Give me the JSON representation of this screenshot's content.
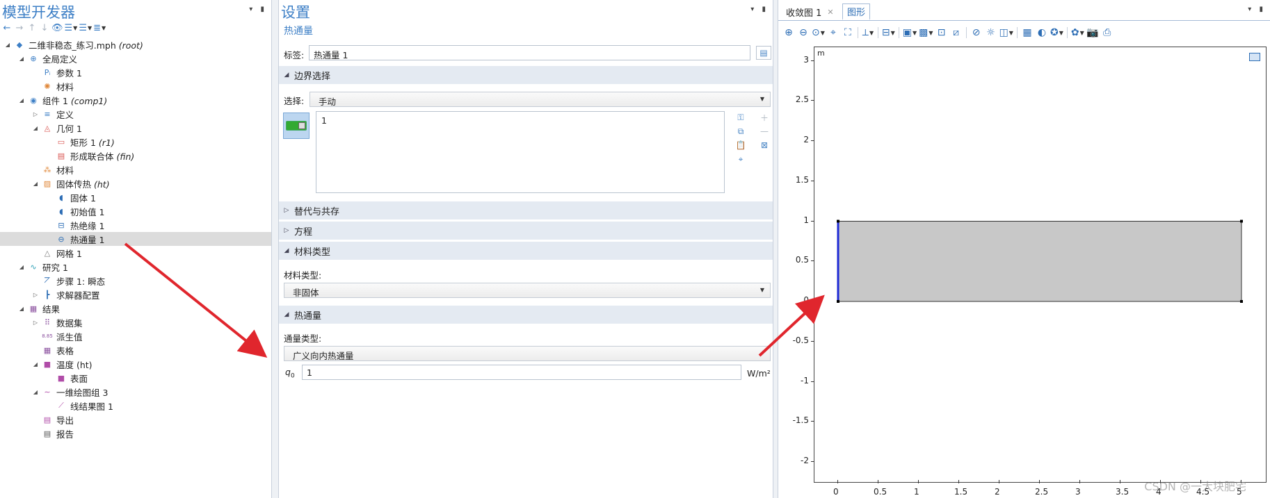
{
  "left": {
    "title": "模型开发器",
    "tree": [
      {
        "label": "二维非稳态_练习.mph",
        "tag": "(root)",
        "level": 0,
        "toggle": "◢",
        "icon": "model-root-icon",
        "glyph": "◆",
        "color": "#3d7fc6"
      },
      {
        "label": "全局定义",
        "tag": "",
        "level": 1,
        "toggle": "◢",
        "icon": "globe-icon",
        "glyph": "⊕",
        "color": "#3d7fc6"
      },
      {
        "label": "参数 1",
        "tag": "",
        "level": 2,
        "toggle": "",
        "icon": "parameters-icon",
        "glyph": "Pᵢ",
        "color": "#3d7fc6"
      },
      {
        "label": "材料",
        "tag": "",
        "level": 2,
        "toggle": "",
        "icon": "material-icon",
        "glyph": "✺",
        "color": "#e0883a"
      },
      {
        "label": "组件 1",
        "tag": "(comp1)",
        "level": 1,
        "toggle": "◢",
        "icon": "component-icon",
        "glyph": "◉",
        "color": "#3d7fc6"
      },
      {
        "label": "定义",
        "tag": "",
        "level": 2,
        "toggle": "▷",
        "icon": "definitions-icon",
        "glyph": "≡",
        "color": "#3d7fc6"
      },
      {
        "label": "几何 1",
        "tag": "",
        "level": 2,
        "toggle": "◢",
        "icon": "geometry-icon",
        "glyph": "◬",
        "color": "#d9534f"
      },
      {
        "label": "矩形 1",
        "tag": "(r1)",
        "level": 3,
        "toggle": "",
        "icon": "rectangle-icon",
        "glyph": "▭",
        "color": "#d9534f"
      },
      {
        "label": "形成联合体",
        "tag": "(fin)",
        "level": 3,
        "toggle": "",
        "icon": "form-union-icon",
        "glyph": "▤",
        "color": "#d9534f"
      },
      {
        "label": "材料",
        "tag": "",
        "level": 2,
        "toggle": "",
        "icon": "materials-icon",
        "glyph": "⁂",
        "color": "#e0883a"
      },
      {
        "label": "固体传热",
        "tag": "(ht)",
        "level": 2,
        "toggle": "◢",
        "icon": "heat-transfer-icon",
        "glyph": "▨",
        "color": "#e0883a"
      },
      {
        "label": "固体 1",
        "tag": "",
        "level": 3,
        "toggle": "",
        "icon": "solid-icon",
        "glyph": "◖",
        "color": "#2c6db5"
      },
      {
        "label": "初始值 1",
        "tag": "",
        "level": 3,
        "toggle": "",
        "icon": "initial-values-icon",
        "glyph": "◖",
        "color": "#2c6db5"
      },
      {
        "label": "热绝缘 1",
        "tag": "",
        "level": 3,
        "toggle": "",
        "icon": "thermal-insulation-icon",
        "glyph": "⊟",
        "color": "#2c6db5"
      },
      {
        "label": "热通量 1",
        "tag": "",
        "level": 3,
        "toggle": "",
        "icon": "heat-flux-icon",
        "glyph": "⊖",
        "color": "#2c6db5",
        "selected": true
      },
      {
        "label": "网格 1",
        "tag": "",
        "level": 2,
        "toggle": "",
        "icon": "mesh-icon",
        "glyph": "△",
        "color": "#777"
      },
      {
        "label": "研究 1",
        "tag": "",
        "level": 1,
        "toggle": "◢",
        "icon": "study-icon",
        "glyph": "∿",
        "color": "#2c9fb5"
      },
      {
        "label": "步骤 1: 瞬态",
        "tag": "",
        "level": 2,
        "toggle": "",
        "icon": "step-icon",
        "glyph": "⦢",
        "color": "#2c6db5"
      },
      {
        "label": "求解器配置",
        "tag": "",
        "level": 2,
        "toggle": "▷",
        "icon": "solver-icon",
        "glyph": "┣",
        "color": "#2c6db5"
      },
      {
        "label": "结果",
        "tag": "",
        "level": 1,
        "toggle": "◢",
        "icon": "results-icon",
        "glyph": "▦",
        "color": "#8a4f9e"
      },
      {
        "label": "数据集",
        "tag": "",
        "level": 2,
        "toggle": "▷",
        "icon": "dataset-icon",
        "glyph": "⠿",
        "color": "#8a4f9e"
      },
      {
        "label": "派生值",
        "tag": "",
        "level": 2,
        "toggle": "",
        "icon": "derived-values-icon",
        "glyph": "8.85",
        "color": "#8a4f9e"
      },
      {
        "label": "表格",
        "tag": "",
        "level": 2,
        "toggle": "",
        "icon": "table-icon",
        "glyph": "▦",
        "color": "#8a4f9e"
      },
      {
        "label": "温度 (ht)",
        "tag": "",
        "level": 2,
        "toggle": "◢",
        "icon": "temperature-plot-icon",
        "glyph": "■",
        "color": "#b04ca8"
      },
      {
        "label": "表面",
        "tag": "",
        "level": 3,
        "toggle": "",
        "icon": "surface-icon",
        "glyph": "■",
        "color": "#b04ca8"
      },
      {
        "label": "一维绘图组 3",
        "tag": "",
        "level": 2,
        "toggle": "◢",
        "icon": "plot1d-icon",
        "glyph": "∼",
        "color": "#b04ca8"
      },
      {
        "label": "线结果图 1",
        "tag": "",
        "level": 3,
        "toggle": "",
        "icon": "line-graph-icon",
        "glyph": "⟋",
        "color": "#b04ca8"
      },
      {
        "label": "导出",
        "tag": "",
        "level": 2,
        "toggle": "",
        "icon": "export-icon",
        "glyph": "▤",
        "color": "#b04ca8"
      },
      {
        "label": "报告",
        "tag": "",
        "level": 2,
        "toggle": "",
        "icon": "report-icon",
        "glyph": "▤",
        "color": "#555"
      }
    ]
  },
  "settings": {
    "title": "设置",
    "subtitle": "热通量",
    "label_caption": "标签:",
    "label_value": "热通量 1",
    "boundary_section": "边界选择",
    "selection_caption": "选择:",
    "selection_value": "手动",
    "selection_list": "1",
    "override_section": "替代与共存",
    "equation_section": "方程",
    "material_type_section": "材料类型",
    "material_type_caption": "材料类型:",
    "material_type_value": "非固体",
    "heat_flux_section": "热通量",
    "flux_type_caption": "通量类型:",
    "flux_type_value": "广义向内热通量",
    "q0_symbol": "q",
    "q0_sub": "0",
    "q0_value": "1",
    "q0_unit": "W/m²"
  },
  "graphics": {
    "tab1": "收敛图 1",
    "tab2": "图形",
    "unit_label": "m",
    "x_ticks": [
      "0",
      "0.5",
      "1",
      "1.5",
      "2",
      "2.5",
      "3",
      "3.5",
      "4",
      "4.5",
      "5"
    ],
    "y_ticks": [
      "3",
      "2.5",
      "2",
      "1.5",
      "1",
      "0.5",
      "0",
      "-0.5",
      "-1",
      "-1.5",
      "-2"
    ],
    "geometry": {
      "x_min": 0,
      "x_max": 5,
      "y_min": 0,
      "y_max": 1
    },
    "highlight_boundary": "left edge x=0",
    "fill_color": "#c8c8c8",
    "highlight_color": "#1f2bd6"
  },
  "watermark": "CSDN @一大块肥宅",
  "colors": {
    "accent": "#3d7fc6",
    "arrow": "#e0262d"
  }
}
